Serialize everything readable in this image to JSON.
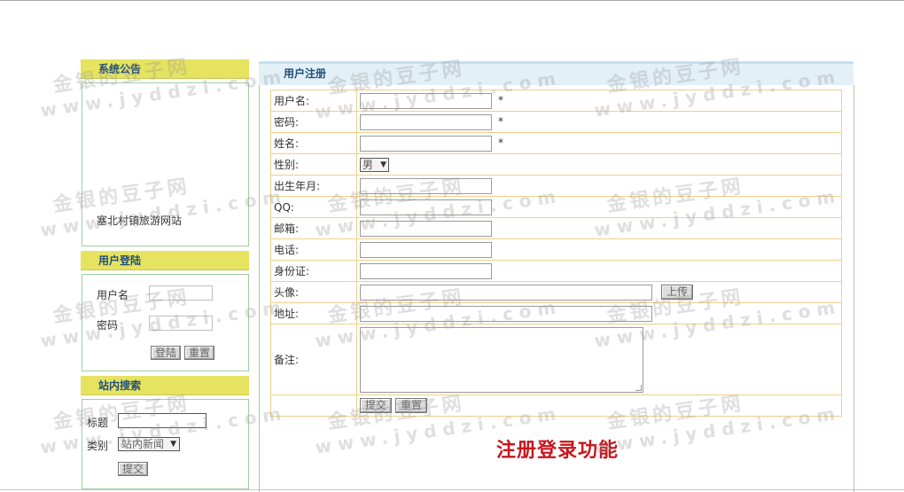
{
  "sidebar": {
    "notice": {
      "title": "系统公告",
      "text": "塞北村镇旅游网站"
    },
    "login": {
      "title": "用户登陆",
      "username_label": "用户名",
      "password_label": "密码",
      "login_button": "登陆",
      "reset_button": "重置"
    },
    "search": {
      "title": "站内搜索",
      "title_label": "标题",
      "category_label": "类别",
      "category_value": "站内新闻",
      "submit_button": "提交"
    }
  },
  "main": {
    "title": "用户注册",
    "fields": {
      "username": "用户名:",
      "password": "密码:",
      "name": "姓名:",
      "gender": "性别:",
      "birth": "出生年月:",
      "qq": "QQ:",
      "email": "邮箱:",
      "phone": "电话:",
      "idcard": "身份证:",
      "avatar": "头像:",
      "address": "地址:",
      "remark": "备注:"
    },
    "required_mark": "*",
    "gender_value": "男",
    "upload_button": "上传",
    "submit_button": "提交",
    "reset_button": "重置"
  },
  "caption": "注册登录功能",
  "watermark": {
    "cn": "金银的豆子网",
    "en": "www.jyddzi.com"
  },
  "colors": {
    "section_header": "#e6e360",
    "header_text": "#1f4f7a",
    "panel_border": "#9fcf9f",
    "table_border": "#f0cf8a",
    "caption": "#c8161d"
  }
}
